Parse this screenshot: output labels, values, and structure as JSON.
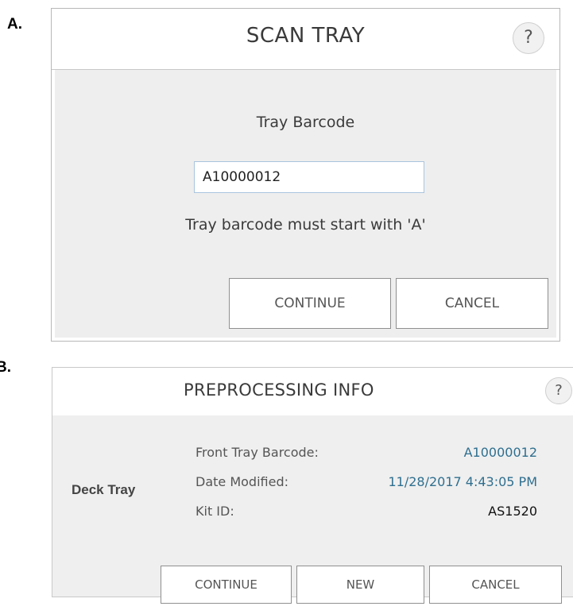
{
  "panel_labels": {
    "a": "A.",
    "b": "B."
  },
  "scan_tray": {
    "title": "SCAN TRAY",
    "help_label": "?",
    "barcode_heading": "Tray Barcode",
    "barcode_value": "A10000012",
    "hint": "Tray barcode must start with 'A'",
    "continue_label": "CONTINUE",
    "cancel_label": "CANCEL"
  },
  "preprocessing_info": {
    "title": "PREPROCESSING INFO",
    "help_label": "?",
    "section_label": "Deck Tray",
    "rows": [
      {
        "label": "Front Tray Barcode:",
        "value": "A10000012"
      },
      {
        "label": "Date Modified:",
        "value": "11/28/2017 4:43:05 PM"
      },
      {
        "label": "Kit ID:",
        "value": "AS1520"
      }
    ],
    "continue_label": "CONTINUE",
    "new_label": "NEW",
    "cancel_label": "CANCEL"
  },
  "colors": {
    "info_value_link": "#2f6f8f",
    "dialog_body": "#eeeeee",
    "button_border": "#8f8f8f"
  }
}
